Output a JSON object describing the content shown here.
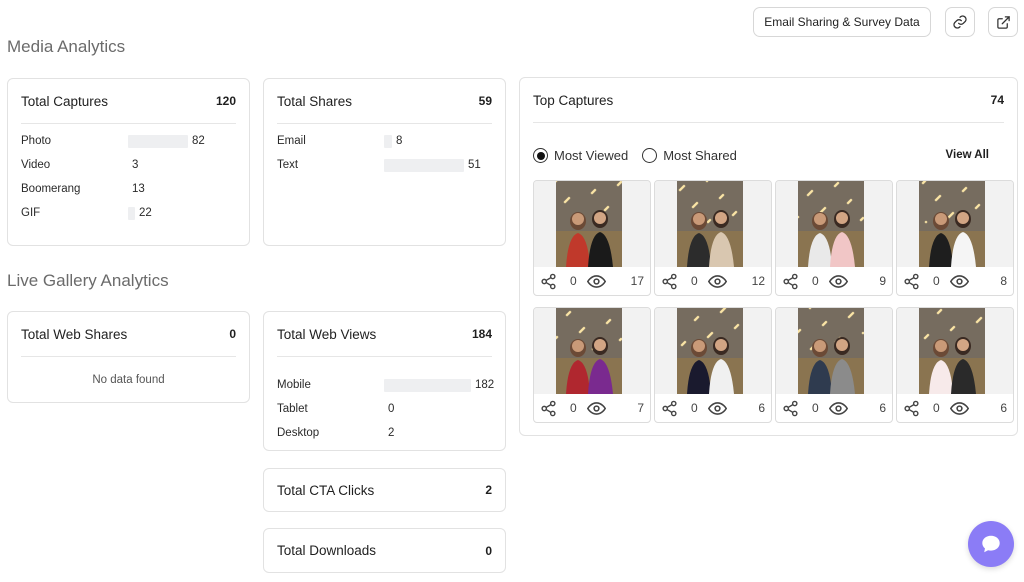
{
  "header": {
    "email_sharing_button": "Email Sharing & Survey Data",
    "link_icon": "link-icon",
    "external_icon": "external-link-icon"
  },
  "media_analytics": {
    "title": "Media Analytics",
    "total_captures": {
      "title": "Total Captures",
      "count": "120",
      "rows": [
        {
          "label": "Photo",
          "value": "82",
          "fraction": 0.68
        },
        {
          "label": "Video",
          "value": "3",
          "fraction": 0.0
        },
        {
          "label": "Boomerang",
          "value": "13",
          "fraction": 0.0
        },
        {
          "label": "GIF",
          "value": "22",
          "fraction": 0.08
        }
      ]
    },
    "total_shares": {
      "title": "Total Shares",
      "count": "59",
      "rows": [
        {
          "label": "Email",
          "value": "8",
          "fraction": 0.1
        },
        {
          "label": "Text",
          "value": "51",
          "fraction": 0.95
        }
      ]
    }
  },
  "live_gallery": {
    "title": "Live Gallery Analytics",
    "total_web_shares": {
      "title": "Total Web Shares",
      "count": "0",
      "empty_text": "No data found"
    },
    "total_web_views": {
      "title": "Total Web Views",
      "count": "184",
      "rows": [
        {
          "label": "Mobile",
          "value": "182",
          "fraction": 0.99
        },
        {
          "label": "Tablet",
          "value": "0",
          "fraction": 0.0
        },
        {
          "label": "Desktop",
          "value": "2",
          "fraction": 0.0
        }
      ]
    },
    "total_cta_clicks": {
      "title": "Total CTA Clicks",
      "count": "2"
    },
    "total_downloads": {
      "title": "Total Downloads",
      "count": "0"
    }
  },
  "top_captures": {
    "title": "Top Captures",
    "count": "74",
    "filter_most_viewed": "Most Viewed",
    "filter_most_shared": "Most Shared",
    "selected_filter": "Most Viewed",
    "view_all": "View All",
    "items": [
      {
        "shares": "0",
        "views": "17"
      },
      {
        "shares": "0",
        "views": "12"
      },
      {
        "shares": "0",
        "views": "9"
      },
      {
        "shares": "0",
        "views": "8"
      },
      {
        "shares": "0",
        "views": "7"
      },
      {
        "shares": "0",
        "views": "6"
      },
      {
        "shares": "0",
        "views": "6"
      },
      {
        "shares": "0",
        "views": "6"
      }
    ]
  },
  "colors": {
    "accent_fab": "#8b7cf6",
    "bar_fill": "#eeeff1",
    "photo_backdrop": "#8a7450"
  }
}
